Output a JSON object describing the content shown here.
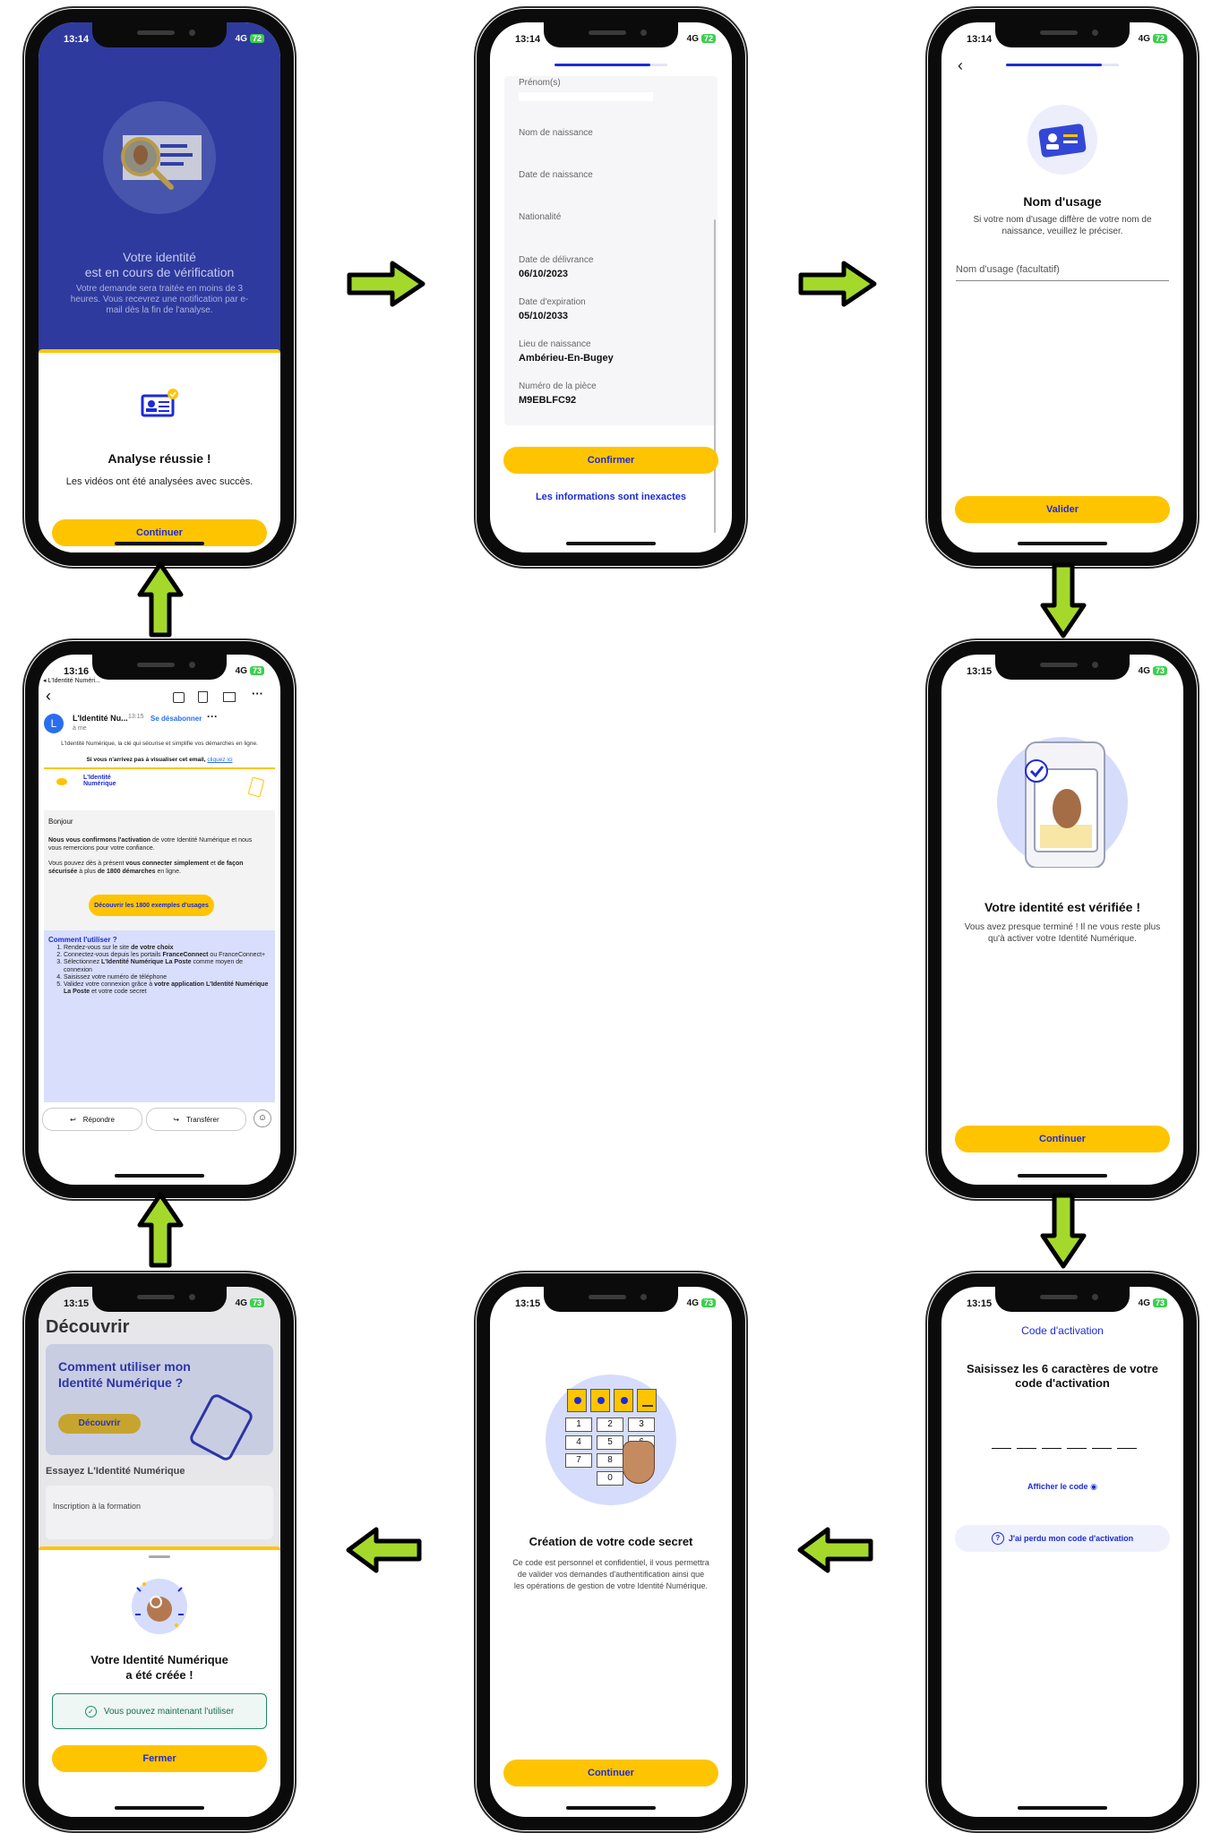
{
  "status": {
    "time_1314": "13:14",
    "time_1316": "13:16",
    "time_1315": "13:15",
    "network": "4G",
    "battery_72": "72",
    "battery_73": "73"
  },
  "screen1": {
    "title_line1": "Votre identité",
    "title_line2": "est en cours de vérification",
    "description": "Votre demande sera traitée en moins de 3 heures. Vous recevrez une notification par e-mail dès la fin de l'analyse.",
    "sheet_title": "Analyse réussie !",
    "sheet_text": "Les vidéos ont été analysées avec succès.",
    "button": "Continuer"
  },
  "screen2": {
    "cut_label": "Prénom(s)",
    "fields": [
      {
        "label": "Nom de naissance",
        "value": ""
      },
      {
        "label": "Date de naissance",
        "value": ""
      },
      {
        "label": "Nationalité",
        "value": ""
      },
      {
        "label": "Date de délivrance",
        "value": "06/10/2023"
      },
      {
        "label": "Date d'expiration",
        "value": "05/10/2033"
      },
      {
        "label": "Lieu de naissance",
        "value": "Ambérieu-En-Bugey"
      },
      {
        "label": "Numéro de la pièce",
        "value": "M9EBLFC92"
      }
    ],
    "confirm_button": "Confirmer",
    "incorrect_link": "Les informations sont inexactes"
  },
  "screen3": {
    "title": "Nom d'usage",
    "text": "Si votre nom d'usage diffère de votre nom de naissance, veuillez le préciser.",
    "input_placeholder": "Nom d'usage (facultatif)",
    "button": "Valider"
  },
  "screen4": {
    "title": "Votre identité est vérifiée !",
    "text": "Vous avez presque terminé ! Il ne vous reste plus qu'à activer votre Identité Numérique.",
    "button": "Continuer"
  },
  "screen5": {
    "back_app": "◂ L'Identité Numéri...",
    "sender_initial": "L",
    "sender": "L'Identité Nu...",
    "time": "13:15",
    "unsubscribe": "Se désabonner",
    "to": "à me",
    "intro": "L'Identité Numérique, la clé qui sécurise et simplifie vos démarches en ligne.",
    "view_line": "Si vous n'arrivez pas à visualiser cet email,",
    "view_link": "cliquez ici",
    "brand_line1": "L'Identité",
    "brand_line2": "Numérique",
    "greeting": "Bonjour",
    "p1_bold": "Nous vous confirmons l'activation",
    "p1_rest": " de votre Identité Numérique et nous vous remercions pour votre confiance.",
    "p2_a": "Vous pouvez dès à présent ",
    "p2_b": "vous connecter simplement",
    "p2_c": " et ",
    "p2_d": "de façon sécurisée",
    "p2_e": " à plus ",
    "p2_f": "de 1800 démarches",
    "p2_g": " en ligne.",
    "cta": "Découvrir les 1800 exemples d'usages",
    "howto_title": "Comment l'utiliser ?",
    "steps": [
      {
        "a": "Rendez-vous sur le site ",
        "b": "de votre choix",
        "c": ""
      },
      {
        "a": "Connectez-vous depuis les portails ",
        "b": "FranceConnect",
        "c": " ou FranceConnect+"
      },
      {
        "a": "Sélectionnez ",
        "b": "L'Identité Numérique La Poste",
        "c": " comme moyen de connexion"
      },
      {
        "a": "Saisissez votre numéro de téléphone",
        "b": "",
        "c": ""
      },
      {
        "a": "Validez votre connexion grâce à ",
        "b": "votre application L'Identité Numérique La Poste",
        "c": " et votre code secret"
      }
    ],
    "reply": "Répondre",
    "forward": "Transférer"
  },
  "screen6": {
    "title": "Code d'activation",
    "instruction": "Saisissez les 6 caractères de votre code d'activation",
    "show_code": "Afficher le code",
    "lost_code": "J'ai perdu mon code d'activation"
  },
  "screen7": {
    "title": "Création de votre code secret",
    "text": "Ce code est personnel et confidentiel, il vous permettra de valider vos demandes d'authentification ainsi que les opérations de gestion de votre Identité Numérique.",
    "keys": [
      "1",
      "2",
      "3",
      "4",
      "5",
      "6",
      "7",
      "8",
      "0"
    ],
    "button": "Continuer"
  },
  "screen8": {
    "header": "Découvrir",
    "card_title": "Comment utiliser mon Identité Numérique ?",
    "card_button": "Découvrir",
    "section": "Essayez L'Identité Numérique",
    "row": "Inscription à la formation",
    "sheet_title_line1": "Votre Identité Numérique",
    "sheet_title_line2": "a été créée !",
    "success_msg": "Vous pouvez maintenant l'utiliser",
    "button": "Fermer"
  },
  "colors": {
    "accent_yellow": "#ffc400",
    "brand_blue": "#1c2bd6",
    "arrow_green": "#a4d92c",
    "success_green": "#1e8a6a"
  }
}
